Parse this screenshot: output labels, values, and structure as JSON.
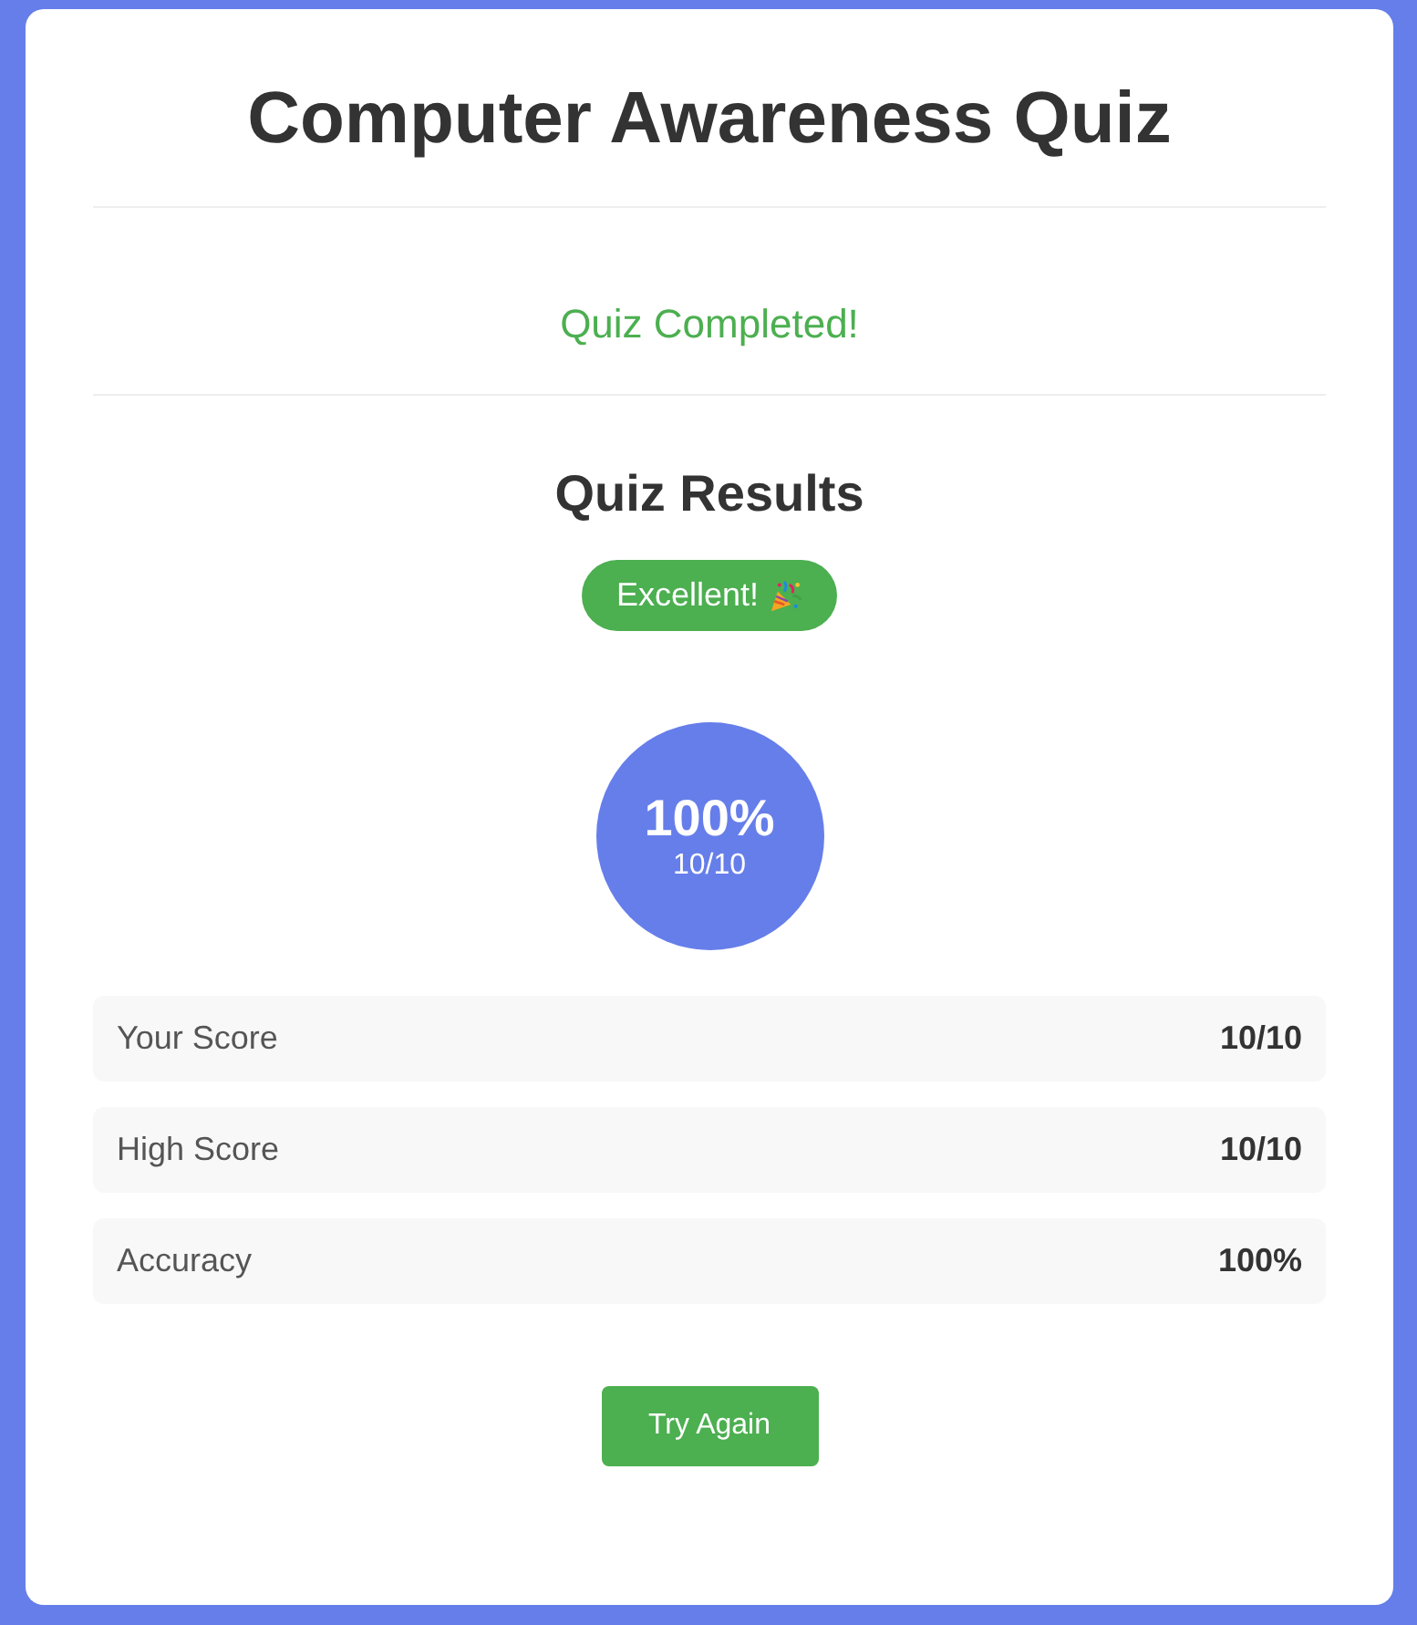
{
  "title": "Computer Awareness Quiz",
  "status": {
    "kind": "success",
    "text": "Quiz Completed!"
  },
  "results": {
    "heading": "Quiz Results",
    "badge": {
      "kind": "success",
      "text": "Excellent!"
    },
    "score_circle": {
      "percent": "100%",
      "fraction": "10/10"
    },
    "stats": [
      {
        "label": "Your Score",
        "value": "10/10"
      },
      {
        "label": "High Score",
        "value": "10/10"
      },
      {
        "label": "Accuracy",
        "value": "100%"
      }
    ]
  },
  "buttons": [
    {
      "label": "Try Again"
    }
  ]
}
